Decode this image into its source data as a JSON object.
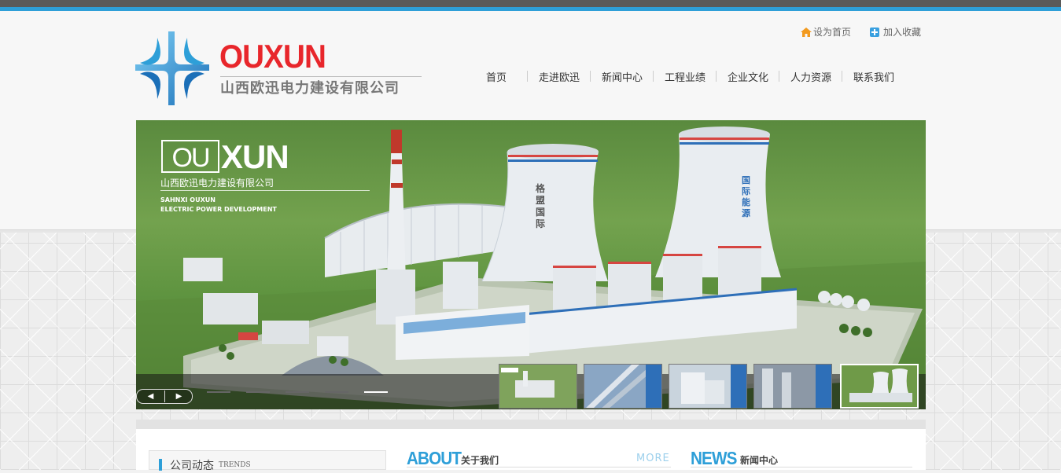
{
  "header": {
    "logo_en": "OUXUN",
    "logo_cn": "山西欧迅电力建设有限公司",
    "top_links": [
      "设为首页",
      "加入收藏"
    ]
  },
  "nav": {
    "items": [
      "首页",
      "走进欧迅",
      "新闻中心",
      "工程业绩",
      "企业文化",
      "人力资源",
      "联系我们"
    ]
  },
  "banner": {
    "logo_ou": "OU",
    "logo_xun": "XUN",
    "cn_name": "山西欧迅电力建设有限公司",
    "en_line1": "SAHNXI OUXUN",
    "en_line2": "ELECTRIC POWER DEVELOPMENT",
    "tower_text_1": "格盟国际",
    "tower_text_2": "国际能源",
    "slide_count": 5,
    "active_slide": 5,
    "thumbnail_count": 5,
    "active_thumbnail": 5
  },
  "content": {
    "trends_cn": "公司动态",
    "trends_en": "TRENDS",
    "about_en": "ABOUT",
    "about_cn": "关于我们",
    "more": "MORE",
    "news_en": "NEWS",
    "news_cn": "新闻中心"
  },
  "colors": {
    "accent": "#2e9fd8",
    "logo_red": "#e8262b",
    "topbar": "#5a5a5a"
  }
}
